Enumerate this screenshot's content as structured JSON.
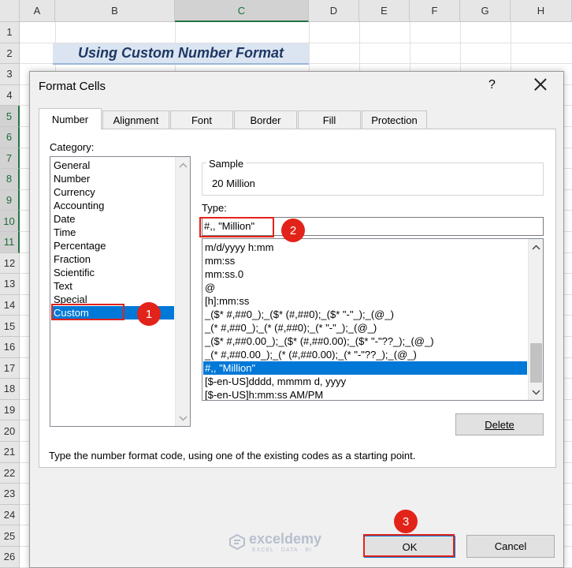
{
  "sheet": {
    "columns": [
      "A",
      "B",
      "C",
      "D",
      "E",
      "F",
      "G",
      "H"
    ],
    "selected_column": "C",
    "rows": [
      "1",
      "2",
      "3",
      "4",
      "5",
      "6",
      "7",
      "8",
      "9",
      "10",
      "11",
      "12",
      "13",
      "14",
      "15",
      "16",
      "17",
      "18",
      "19",
      "20",
      "21",
      "22",
      "23",
      "24",
      "25",
      "26"
    ],
    "selected_rows": [
      "5",
      "6",
      "7",
      "8",
      "9",
      "10",
      "11"
    ],
    "title_cell": "Using Custom Number Format"
  },
  "dialog": {
    "title": "Format Cells",
    "help_label": "?",
    "tabs": [
      "Number",
      "Alignment",
      "Font",
      "Border",
      "Fill",
      "Protection"
    ],
    "active_tab": "Number",
    "category_label": "Category:",
    "categories": [
      "General",
      "Number",
      "Currency",
      "Accounting",
      "Date",
      "Time",
      "Percentage",
      "Fraction",
      "Scientific",
      "Text",
      "Special",
      "Custom"
    ],
    "selected_category": "Custom",
    "sample_label": "Sample",
    "sample_value": "20 Million",
    "type_label": "Type:",
    "type_value": "#,, \"Million\"",
    "format_codes": [
      "m/d/yyyy h:mm",
      "mm:ss",
      "mm:ss.0",
      "@",
      "[h]:mm:ss",
      "_($* #,##0_);_($* (#,##0);_($* \"-\"_);_(@_)",
      "_(* #,##0_);_(* (#,##0);_(* \"-\"_);_(@_)",
      "_($* #,##0.00_);_($* (#,##0.00);_($* \"-\"??_);_(@_)",
      "_(* #,##0.00_);_(* (#,##0.00);_(* \"-\"??_);_(@_)",
      "#,, \"Million\"",
      "[$-en-US]dddd, mmmm d, yyyy",
      "[$-en-US]h:mm:ss AM/PM"
    ],
    "selected_format": "#,, \"Million\"",
    "delete_label": "Delete",
    "hint": "Type the number format code, using one of the existing codes as a starting point.",
    "ok_label": "OK",
    "cancel_label": "Cancel"
  },
  "annotations": [
    "1",
    "2",
    "3"
  ],
  "watermark": {
    "name": "exceldemy",
    "tagline": "EXCEL · DATA · BI"
  },
  "colors": {
    "accent": "#e2231a",
    "selection": "#0078d7",
    "header_title_bg": "#dbe5f1"
  }
}
